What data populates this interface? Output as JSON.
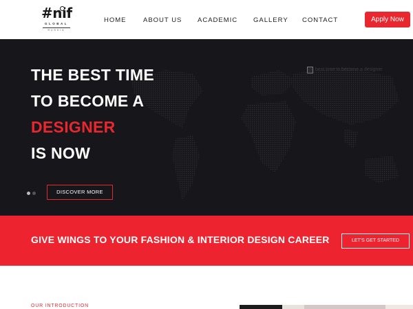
{
  "logo": {
    "mark": "#nif",
    "sub": "GLOBAL",
    "sub2": "RUSSIA"
  },
  "nav": {
    "items": [
      {
        "label": "HOME"
      },
      {
        "label": "ABOUT US"
      },
      {
        "label": "ACADEMIC"
      },
      {
        "label": "GALLERY"
      },
      {
        "label": "CONTACT"
      }
    ],
    "apply_label": "Apply Now"
  },
  "hero": {
    "lines": [
      "THE BEST TIME",
      "TO BECOME A",
      "DESIGNER",
      "IS NOW"
    ],
    "broken_image_alt": "best time to become a designer",
    "discover_label": "DISCOVER MORE",
    "slides": 2,
    "active_slide": 1
  },
  "banner": {
    "text": "GIVE WINGS TO YOUR FASHION & INTERIOR DESIGN CAREER",
    "button_label": "LET'S GET STARTED"
  },
  "intro": {
    "label": "OUR INTRODUCTION"
  },
  "colors": {
    "accent": "#e8272f",
    "hero_bg": "#17171b",
    "banner_bg": "#ee2330"
  }
}
